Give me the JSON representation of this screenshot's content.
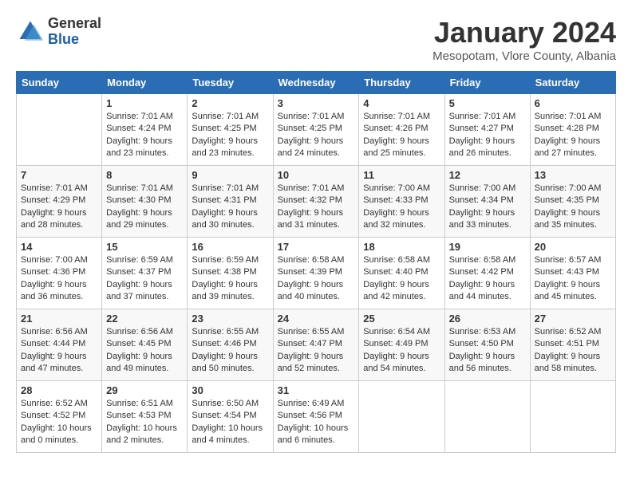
{
  "header": {
    "logo": {
      "general": "General",
      "blue": "Blue"
    },
    "title": "January 2024",
    "subtitle": "Mesopotam, Vlore County, Albania"
  },
  "days_of_week": [
    "Sunday",
    "Monday",
    "Tuesday",
    "Wednesday",
    "Thursday",
    "Friday",
    "Saturday"
  ],
  "weeks": [
    [
      {
        "day": "",
        "info": ""
      },
      {
        "day": "1",
        "info": "Sunrise: 7:01 AM\nSunset: 4:24 PM\nDaylight: 9 hours\nand 23 minutes."
      },
      {
        "day": "2",
        "info": "Sunrise: 7:01 AM\nSunset: 4:25 PM\nDaylight: 9 hours\nand 23 minutes."
      },
      {
        "day": "3",
        "info": "Sunrise: 7:01 AM\nSunset: 4:25 PM\nDaylight: 9 hours\nand 24 minutes."
      },
      {
        "day": "4",
        "info": "Sunrise: 7:01 AM\nSunset: 4:26 PM\nDaylight: 9 hours\nand 25 minutes."
      },
      {
        "day": "5",
        "info": "Sunrise: 7:01 AM\nSunset: 4:27 PM\nDaylight: 9 hours\nand 26 minutes."
      },
      {
        "day": "6",
        "info": "Sunrise: 7:01 AM\nSunset: 4:28 PM\nDaylight: 9 hours\nand 27 minutes."
      }
    ],
    [
      {
        "day": "7",
        "info": "Sunrise: 7:01 AM\nSunset: 4:29 PM\nDaylight: 9 hours\nand 28 minutes."
      },
      {
        "day": "8",
        "info": "Sunrise: 7:01 AM\nSunset: 4:30 PM\nDaylight: 9 hours\nand 29 minutes."
      },
      {
        "day": "9",
        "info": "Sunrise: 7:01 AM\nSunset: 4:31 PM\nDaylight: 9 hours\nand 30 minutes."
      },
      {
        "day": "10",
        "info": "Sunrise: 7:01 AM\nSunset: 4:32 PM\nDaylight: 9 hours\nand 31 minutes."
      },
      {
        "day": "11",
        "info": "Sunrise: 7:00 AM\nSunset: 4:33 PM\nDaylight: 9 hours\nand 32 minutes."
      },
      {
        "day": "12",
        "info": "Sunrise: 7:00 AM\nSunset: 4:34 PM\nDaylight: 9 hours\nand 33 minutes."
      },
      {
        "day": "13",
        "info": "Sunrise: 7:00 AM\nSunset: 4:35 PM\nDaylight: 9 hours\nand 35 minutes."
      }
    ],
    [
      {
        "day": "14",
        "info": "Sunrise: 7:00 AM\nSunset: 4:36 PM\nDaylight: 9 hours\nand 36 minutes."
      },
      {
        "day": "15",
        "info": "Sunrise: 6:59 AM\nSunset: 4:37 PM\nDaylight: 9 hours\nand 37 minutes."
      },
      {
        "day": "16",
        "info": "Sunrise: 6:59 AM\nSunset: 4:38 PM\nDaylight: 9 hours\nand 39 minutes."
      },
      {
        "day": "17",
        "info": "Sunrise: 6:58 AM\nSunset: 4:39 PM\nDaylight: 9 hours\nand 40 minutes."
      },
      {
        "day": "18",
        "info": "Sunrise: 6:58 AM\nSunset: 4:40 PM\nDaylight: 9 hours\nand 42 minutes."
      },
      {
        "day": "19",
        "info": "Sunrise: 6:58 AM\nSunset: 4:42 PM\nDaylight: 9 hours\nand 44 minutes."
      },
      {
        "day": "20",
        "info": "Sunrise: 6:57 AM\nSunset: 4:43 PM\nDaylight: 9 hours\nand 45 minutes."
      }
    ],
    [
      {
        "day": "21",
        "info": "Sunrise: 6:56 AM\nSunset: 4:44 PM\nDaylight: 9 hours\nand 47 minutes."
      },
      {
        "day": "22",
        "info": "Sunrise: 6:56 AM\nSunset: 4:45 PM\nDaylight: 9 hours\nand 49 minutes."
      },
      {
        "day": "23",
        "info": "Sunrise: 6:55 AM\nSunset: 4:46 PM\nDaylight: 9 hours\nand 50 minutes."
      },
      {
        "day": "24",
        "info": "Sunrise: 6:55 AM\nSunset: 4:47 PM\nDaylight: 9 hours\nand 52 minutes."
      },
      {
        "day": "25",
        "info": "Sunrise: 6:54 AM\nSunset: 4:49 PM\nDaylight: 9 hours\nand 54 minutes."
      },
      {
        "day": "26",
        "info": "Sunrise: 6:53 AM\nSunset: 4:50 PM\nDaylight: 9 hours\nand 56 minutes."
      },
      {
        "day": "27",
        "info": "Sunrise: 6:52 AM\nSunset: 4:51 PM\nDaylight: 9 hours\nand 58 minutes."
      }
    ],
    [
      {
        "day": "28",
        "info": "Sunrise: 6:52 AM\nSunset: 4:52 PM\nDaylight: 10 hours\nand 0 minutes."
      },
      {
        "day": "29",
        "info": "Sunrise: 6:51 AM\nSunset: 4:53 PM\nDaylight: 10 hours\nand 2 minutes."
      },
      {
        "day": "30",
        "info": "Sunrise: 6:50 AM\nSunset: 4:54 PM\nDaylight: 10 hours\nand 4 minutes."
      },
      {
        "day": "31",
        "info": "Sunrise: 6:49 AM\nSunset: 4:56 PM\nDaylight: 10 hours\nand 6 minutes."
      },
      {
        "day": "",
        "info": ""
      },
      {
        "day": "",
        "info": ""
      },
      {
        "day": "",
        "info": ""
      }
    ]
  ]
}
